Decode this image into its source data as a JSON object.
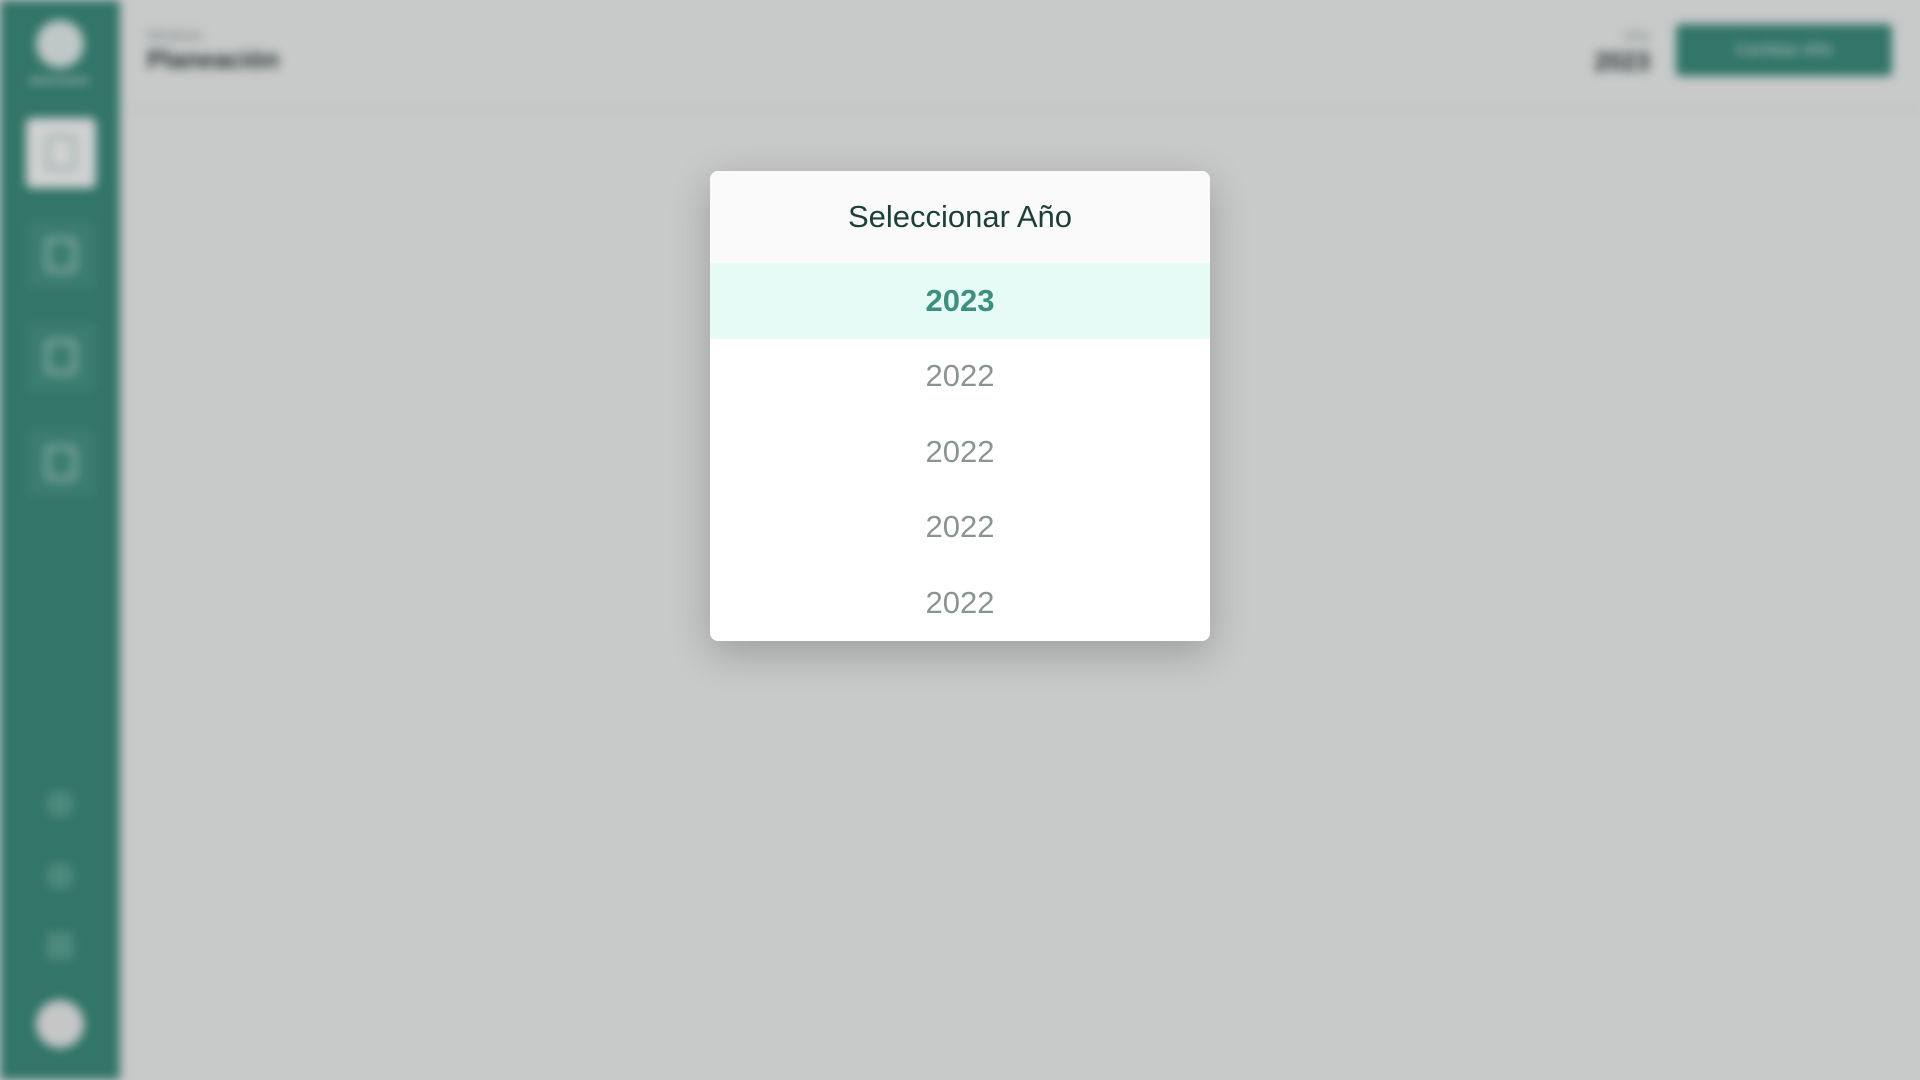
{
  "sidebar": {
    "logo_text": "BIENVENIDO",
    "nav_items": [
      {
        "icon": "clipboard-icon"
      },
      {
        "icon": "user-search-icon"
      },
      {
        "icon": "chart-icon"
      },
      {
        "icon": "document-icon"
      }
    ],
    "bottom_icons": [
      "settings-icon",
      "bell-icon",
      "logout-icon"
    ]
  },
  "header": {
    "module_label": "Módulo",
    "module_title": "Planeación",
    "year_label": "Año",
    "year_value": "2023",
    "change_year_button": "Cambiar Año"
  },
  "modal": {
    "title": "Seleccionar Año",
    "options": [
      {
        "label": "2023",
        "selected": true
      },
      {
        "label": "2022",
        "selected": false
      },
      {
        "label": "2022",
        "selected": false
      },
      {
        "label": "2022",
        "selected": false
      },
      {
        "label": "2022",
        "selected": false
      }
    ]
  },
  "colors": {
    "brand": "#3d8f80",
    "selected_bg": "#e6faf6",
    "title_text": "#1d3f3a",
    "option_text": "#8a9593"
  }
}
